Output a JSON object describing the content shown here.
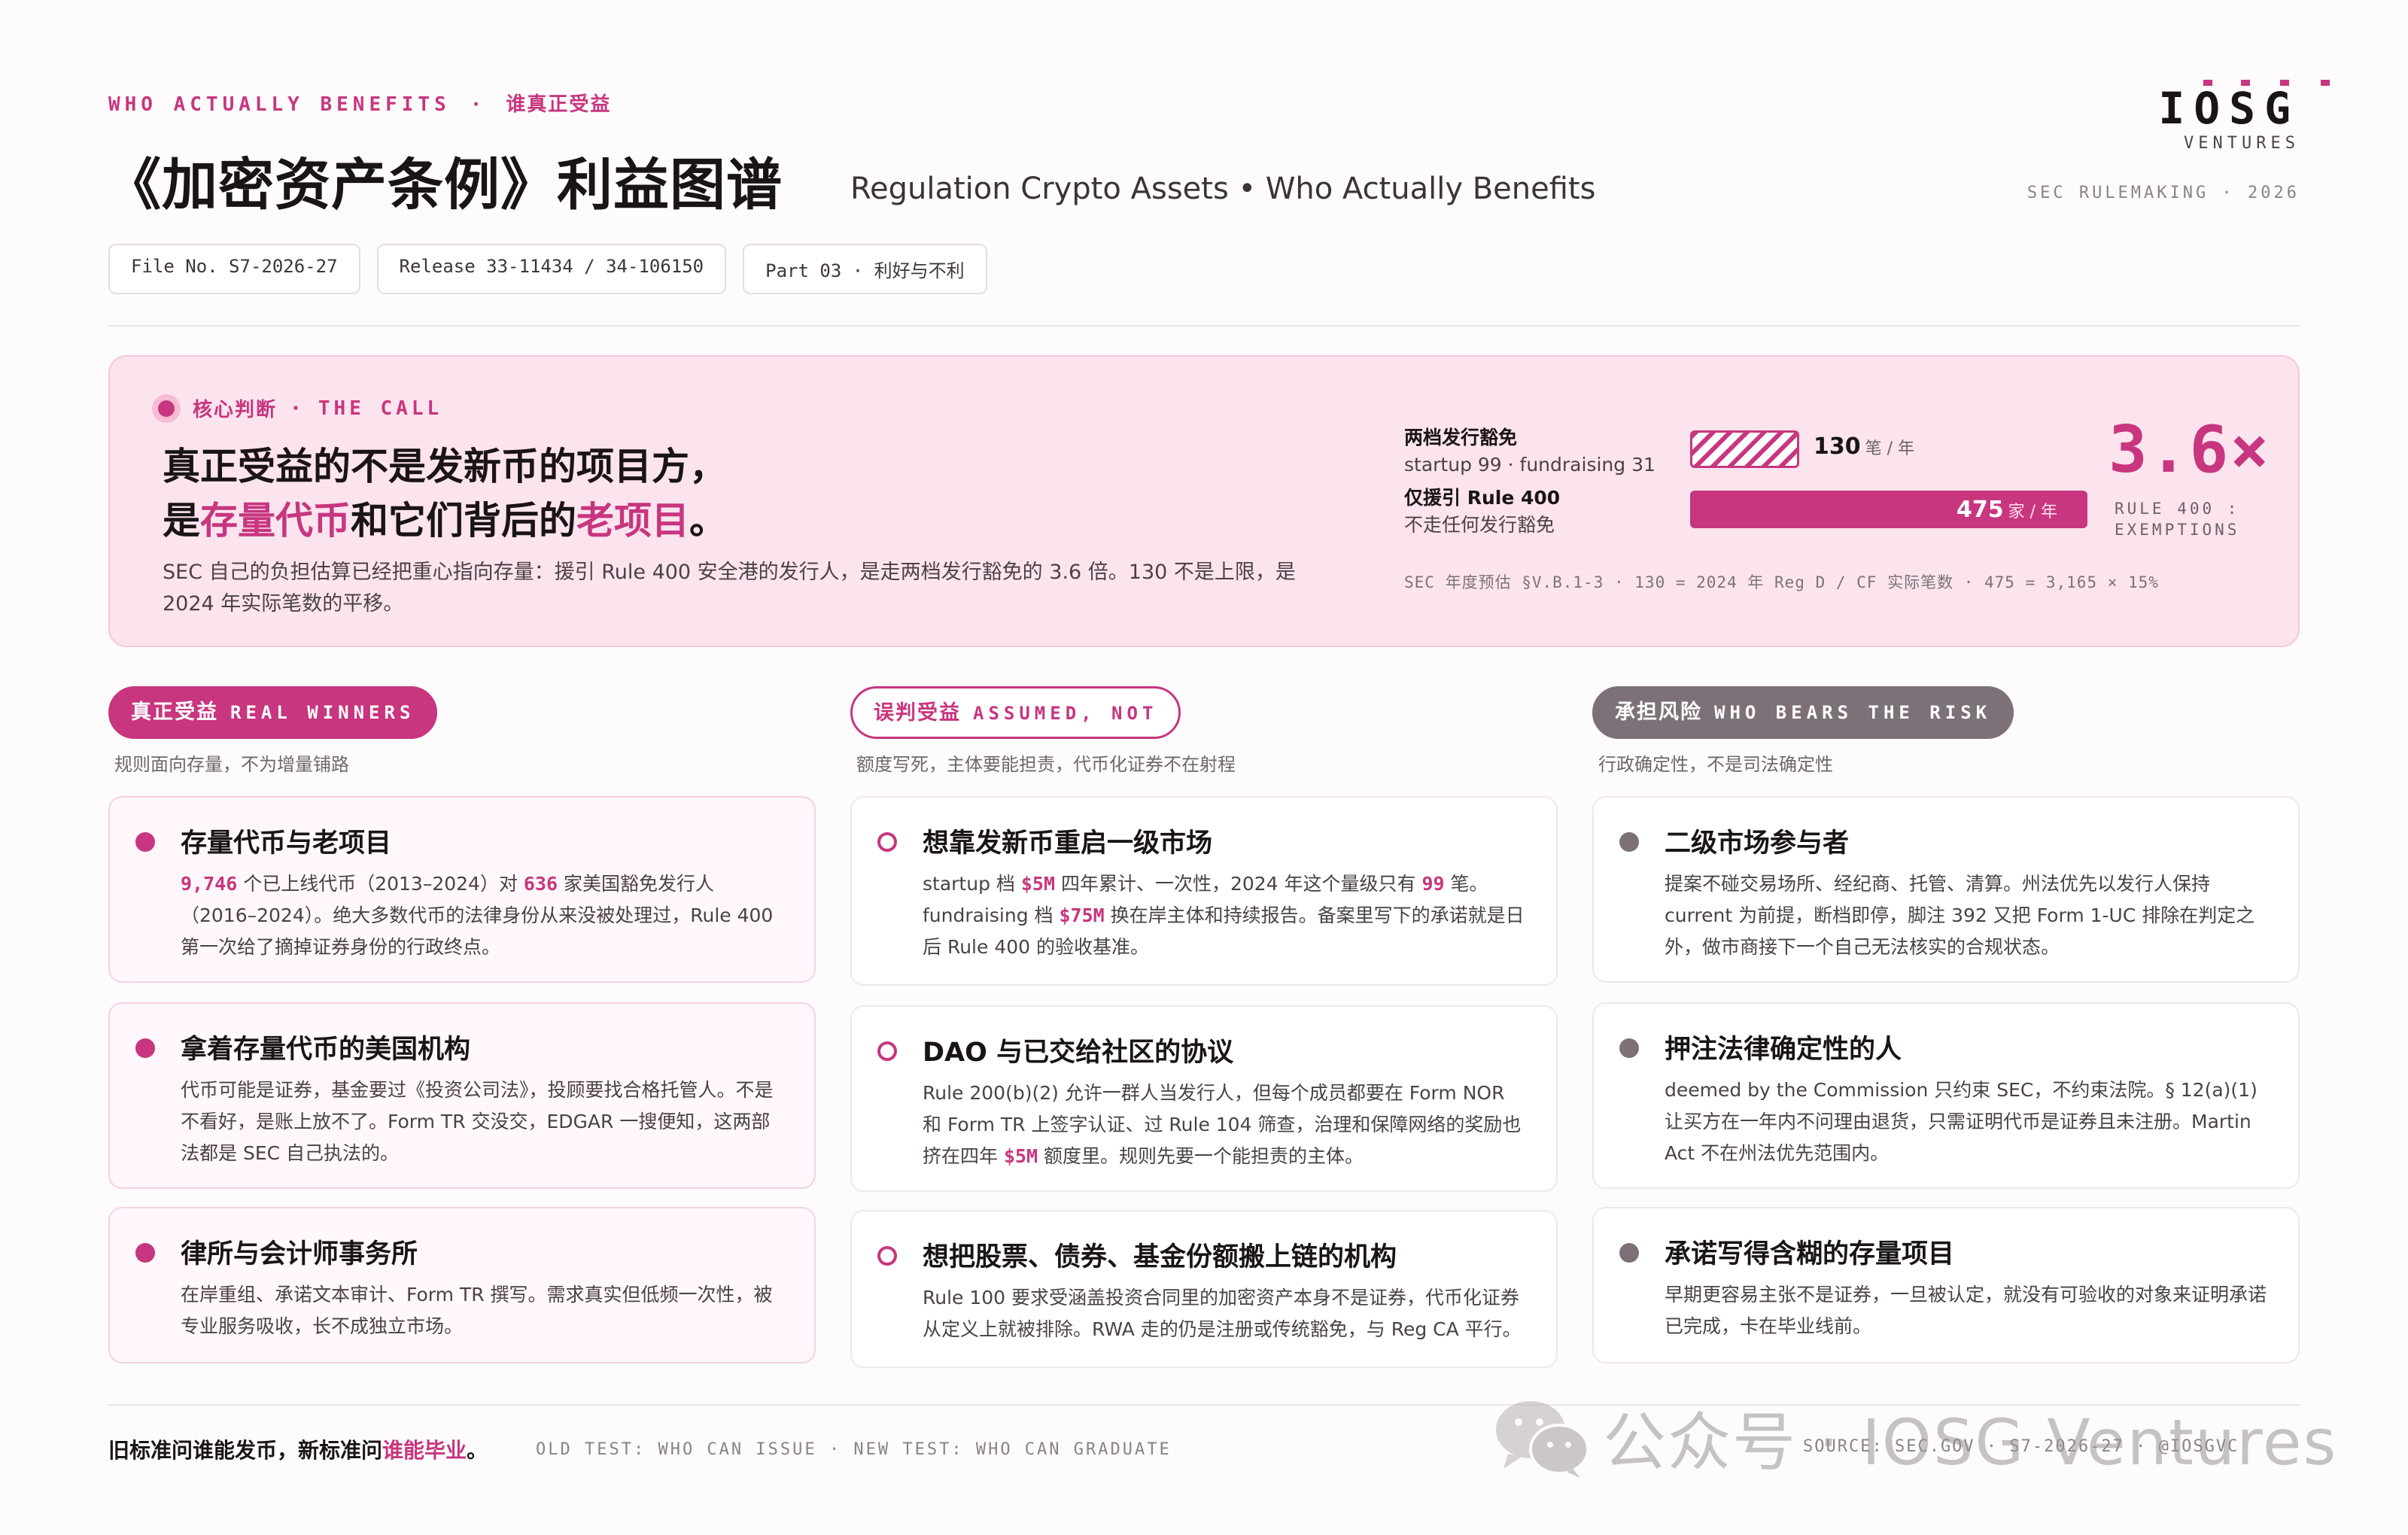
{
  "header": {
    "eyebrow_en": "WHO ACTUALLY BENEFITS",
    "eyebrow_sep": "·",
    "eyebrow_zh": "谁真正受益",
    "title": "《加密资产条例》利益图谱",
    "subtitle": "Regulation Crypto Assets • Who Actually Benefits",
    "chips": [
      "File No. S7-2026-27",
      "Release 33-11434 / 34-106150",
      "Part 03 · 利好与不利"
    ],
    "logo_word": "IOSG",
    "logo_sub": "VENTURES",
    "rulemaking": "SEC RULEMAKING · 2026"
  },
  "call": {
    "tag_zh": "核心判断",
    "tag_sep": "·",
    "tag_en": "THE CALL",
    "headline_l1": "真正受益的不是发新币的项目方，",
    "headline_l2_a": "是",
    "headline_l2_b": "存量代币",
    "headline_l2_c": "和它们背后的",
    "headline_l2_d": "老项目",
    "headline_l2_e": "。",
    "body": "SEC 自己的负担估算已经把重心指向存量：援引 Rule 400 安全港的发行人，是走两档发行豁免的 3.6 倍。130 不是上限，是 2024 年实际笔数的平移。",
    "stat1_title": "两档发行豁免",
    "stat1_sub": "startup 99 · fundraising 31",
    "stat2_title": "仅援引 Rule 400",
    "stat2_sub": "不走任何发行豁免",
    "bar1_value": "130",
    "bar1_unit": "笔 / 年",
    "bar2_value": "475",
    "bar2_unit": "家 / 年",
    "ratio_fraction": 0.2737,
    "big_number": "3.6×",
    "big_caption_l1": "RULE 400 :",
    "big_caption_l2": "EXEMPTIONS",
    "note": "SEC 年度预估 §V.B.1-3 · 130 = 2024 年 Reg D / CF 实际笔数 · 475 = 3,165 × 15%"
  },
  "columns": [
    {
      "pill_zh": "真正受益",
      "pill_en": "REAL WINNERS",
      "sub": "规则面向存量，不为增量铺路",
      "cards": [
        {
          "title": "存量代币与老项目",
          "b1": "9,746",
          "t1": " 个已上线代币（2013–2024）对 ",
          "b2": "636",
          "t2": " 家美国豁免发行人（2016–2024）。绝大多数代币的法律身份从来没被处理过，Rule 400 第一次给了摘掉证券身份的行政终点。"
        },
        {
          "title": "拿着存量代币的美国机构",
          "body": "代币可能是证券，基金要过《投资公司法》，投顾要找合格托管人。不是不看好，是账上放不了。Form TR 交没交，EDGAR 一搜便知，这两部法都是 SEC 自己执法的。"
        },
        {
          "title": "律所与会计师事务所",
          "body": "在岸重组、承诺文本审计、Form TR 撰写。需求真实但低频一次性，被专业服务吸收，长不成独立市场。"
        }
      ]
    },
    {
      "pill_zh": "误判受益",
      "pill_en": "ASSUMED, NOT",
      "sub": "额度写死，主体要能担责，代币化证券不在射程",
      "cards": [
        {
          "title": "想靠发新币重启一级市场",
          "t0": "startup 档 ",
          "b1": "$5M",
          "t1": " 四年累计、一次性，2024 年这个量级只有 ",
          "b2": "99",
          "t2": " 笔。fundraising 档 ",
          "b3": "$75M",
          "t3": " 换在岸主体和持续报告。备案里写下的承诺就是日后 Rule 400 的验收基准。"
        },
        {
          "title": "DAO 与已交给社区的协议",
          "t0": "Rule 200(b)(2) 允许一群人当发行人，但每个成员都要在 Form NOR 和 Form TR 上签字认证、过 Rule 104 筛查，治理和保障网络的奖励也挤在四年 ",
          "b1": "$5M",
          "t1": " 额度里。规则先要一个能担责的主体。"
        },
        {
          "title": "想把股票、债券、基金份额搬上链的机构",
          "body": "Rule 100 要求受涵盖投资合同里的加密资产本身不是证券，代币化证券从定义上就被排除。RWA 走的仍是注册或传统豁免，与 Reg CA 平行。"
        }
      ]
    },
    {
      "pill_zh": "承担风险",
      "pill_en": "WHO BEARS THE RISK",
      "sub": "行政确定性，不是司法确定性",
      "cards": [
        {
          "title": "二级市场参与者",
          "body": "提案不碰交易场所、经纪商、托管、清算。州法优先以发行人保持 current 为前提，断档即停，脚注 392 又把 Form 1-UC 排除在判定之外，做市商接下一个自己无法核实的合规状态。"
        },
        {
          "title": "押注法律确定性的人",
          "body": "deemed by the Commission 只约束 SEC，不约束法院。§ 12(a)(1) 让买方在一年内不问理由退货，只需证明代币是证券且未注册。Martin Act 不在州法优先范围内。"
        },
        {
          "title": "承诺写得含糊的存量项目",
          "body": "早期更容易主张不是证券，一旦被认定，就没有可验收的对象来证明承诺已完成，卡在毕业线前。"
        }
      ]
    }
  ],
  "footer": {
    "left_a": "旧标准问谁能发币，新标准问",
    "left_b": "谁能毕业",
    "left_c": "。",
    "en": "OLD TEST: WHO CAN ISSUE · NEW TEST: WHO CAN GRADUATE",
    "source": "SOURCE: SEC.GOV · S7-2026-27 · @IOSGVC",
    "watermark": "公众号 · IOSG Ventures"
  },
  "colors": {
    "accent": "#c7367e",
    "panel_bg": "#fce4ef",
    "risk_grey": "#7d7179"
  }
}
